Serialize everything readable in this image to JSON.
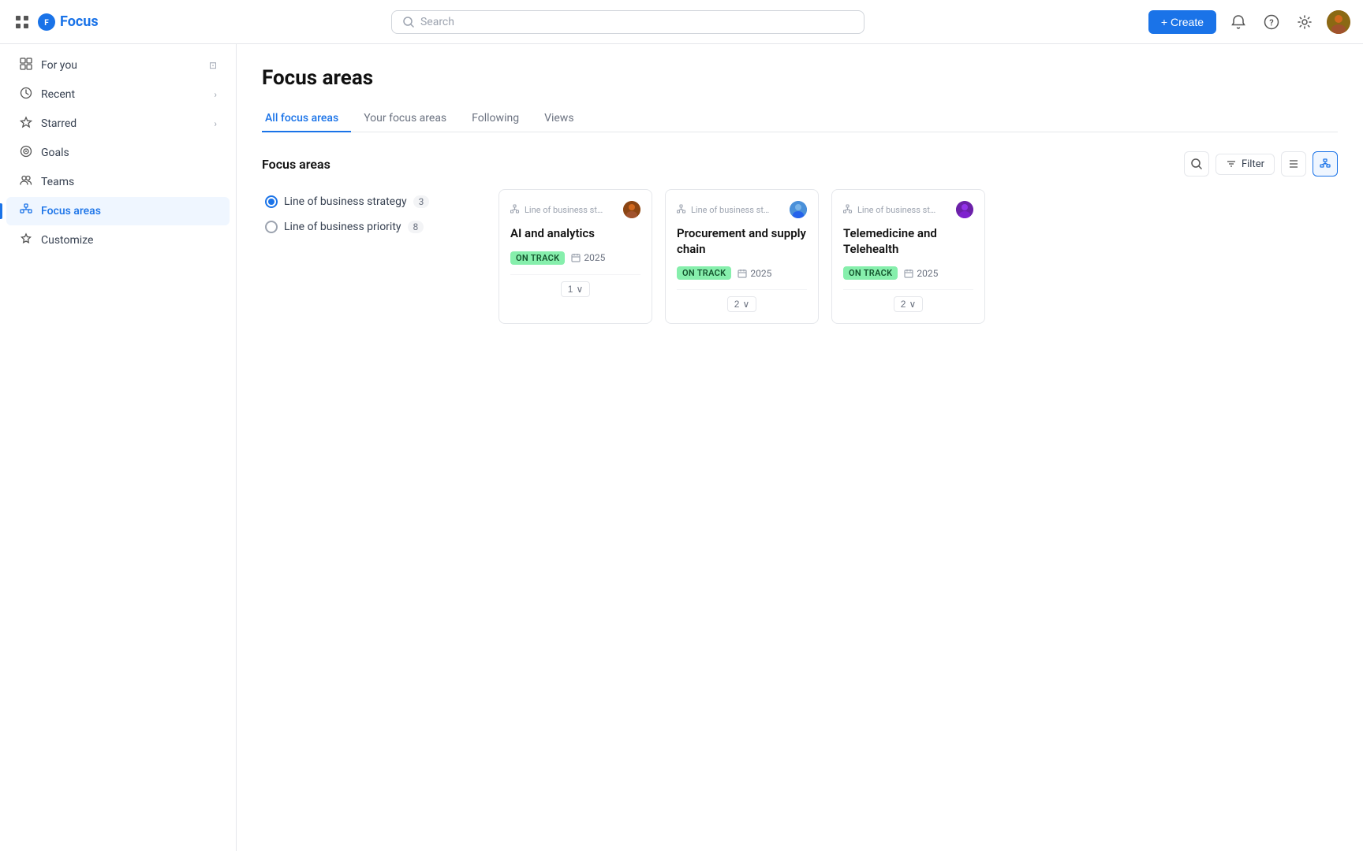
{
  "header": {
    "grid_icon": "⊞",
    "logo_text": "Focus",
    "search_placeholder": "Search",
    "create_label": "+ Create",
    "bell_icon": "🔔",
    "help_icon": "?",
    "settings_icon": "⚙",
    "avatar_initials": "U"
  },
  "sidebar": {
    "items": [
      {
        "id": "for-you",
        "icon": "⊡",
        "label": "For you",
        "extra": "",
        "arrow": ""
      },
      {
        "id": "recent",
        "icon": "🕐",
        "label": "Recent",
        "extra": "",
        "arrow": "›"
      },
      {
        "id": "starred",
        "icon": "☆",
        "label": "Starred",
        "extra": "",
        "arrow": "›"
      },
      {
        "id": "goals",
        "icon": "◎",
        "label": "Goals",
        "extra": "",
        "arrow": ""
      },
      {
        "id": "teams",
        "icon": "👥",
        "label": "Teams",
        "extra": "",
        "arrow": ""
      },
      {
        "id": "focus-areas",
        "icon": "⬡",
        "label": "Focus areas",
        "extra": "",
        "arrow": "",
        "active": true
      },
      {
        "id": "customize",
        "icon": "✦",
        "label": "Customize",
        "extra": "",
        "arrow": ""
      }
    ]
  },
  "page": {
    "title": "Focus areas",
    "tabs": [
      {
        "id": "all",
        "label": "All focus areas",
        "active": true
      },
      {
        "id": "your",
        "label": "Your focus areas",
        "active": false
      },
      {
        "id": "following",
        "label": "Following",
        "active": false
      },
      {
        "id": "views",
        "label": "Views",
        "active": false
      }
    ],
    "section_title": "Focus areas",
    "filter_label": "Filter",
    "groups": [
      {
        "id": "strategy",
        "label": "Line of business strategy",
        "count": "3",
        "selected": true
      },
      {
        "id": "priority",
        "label": "Line of business priority",
        "count": "8",
        "selected": false
      }
    ],
    "cards": [
      {
        "id": "ai-analytics",
        "meta_icon": "team",
        "meta_text": "Line of business stra...",
        "status": "ON TRACK",
        "year": "2025",
        "title": "AI and analytics",
        "expand_count": "1"
      },
      {
        "id": "procurement",
        "meta_icon": "team",
        "meta_text": "Line of business stra...",
        "status": "ON TRACK",
        "year": "2025",
        "title": "Procurement and supply chain",
        "expand_count": "2"
      },
      {
        "id": "telemedicine",
        "meta_icon": "team",
        "meta_text": "Line of business stra...",
        "status": "ON TRACK",
        "year": "2025",
        "title": "Telemedicine and Telehealth",
        "expand_count": "2"
      }
    ],
    "colors": {
      "active_tab": "#1a73e8",
      "active_sidebar": "#1a73e8",
      "on_track_bg": "#86efac",
      "on_track_text": "#14532d"
    }
  }
}
